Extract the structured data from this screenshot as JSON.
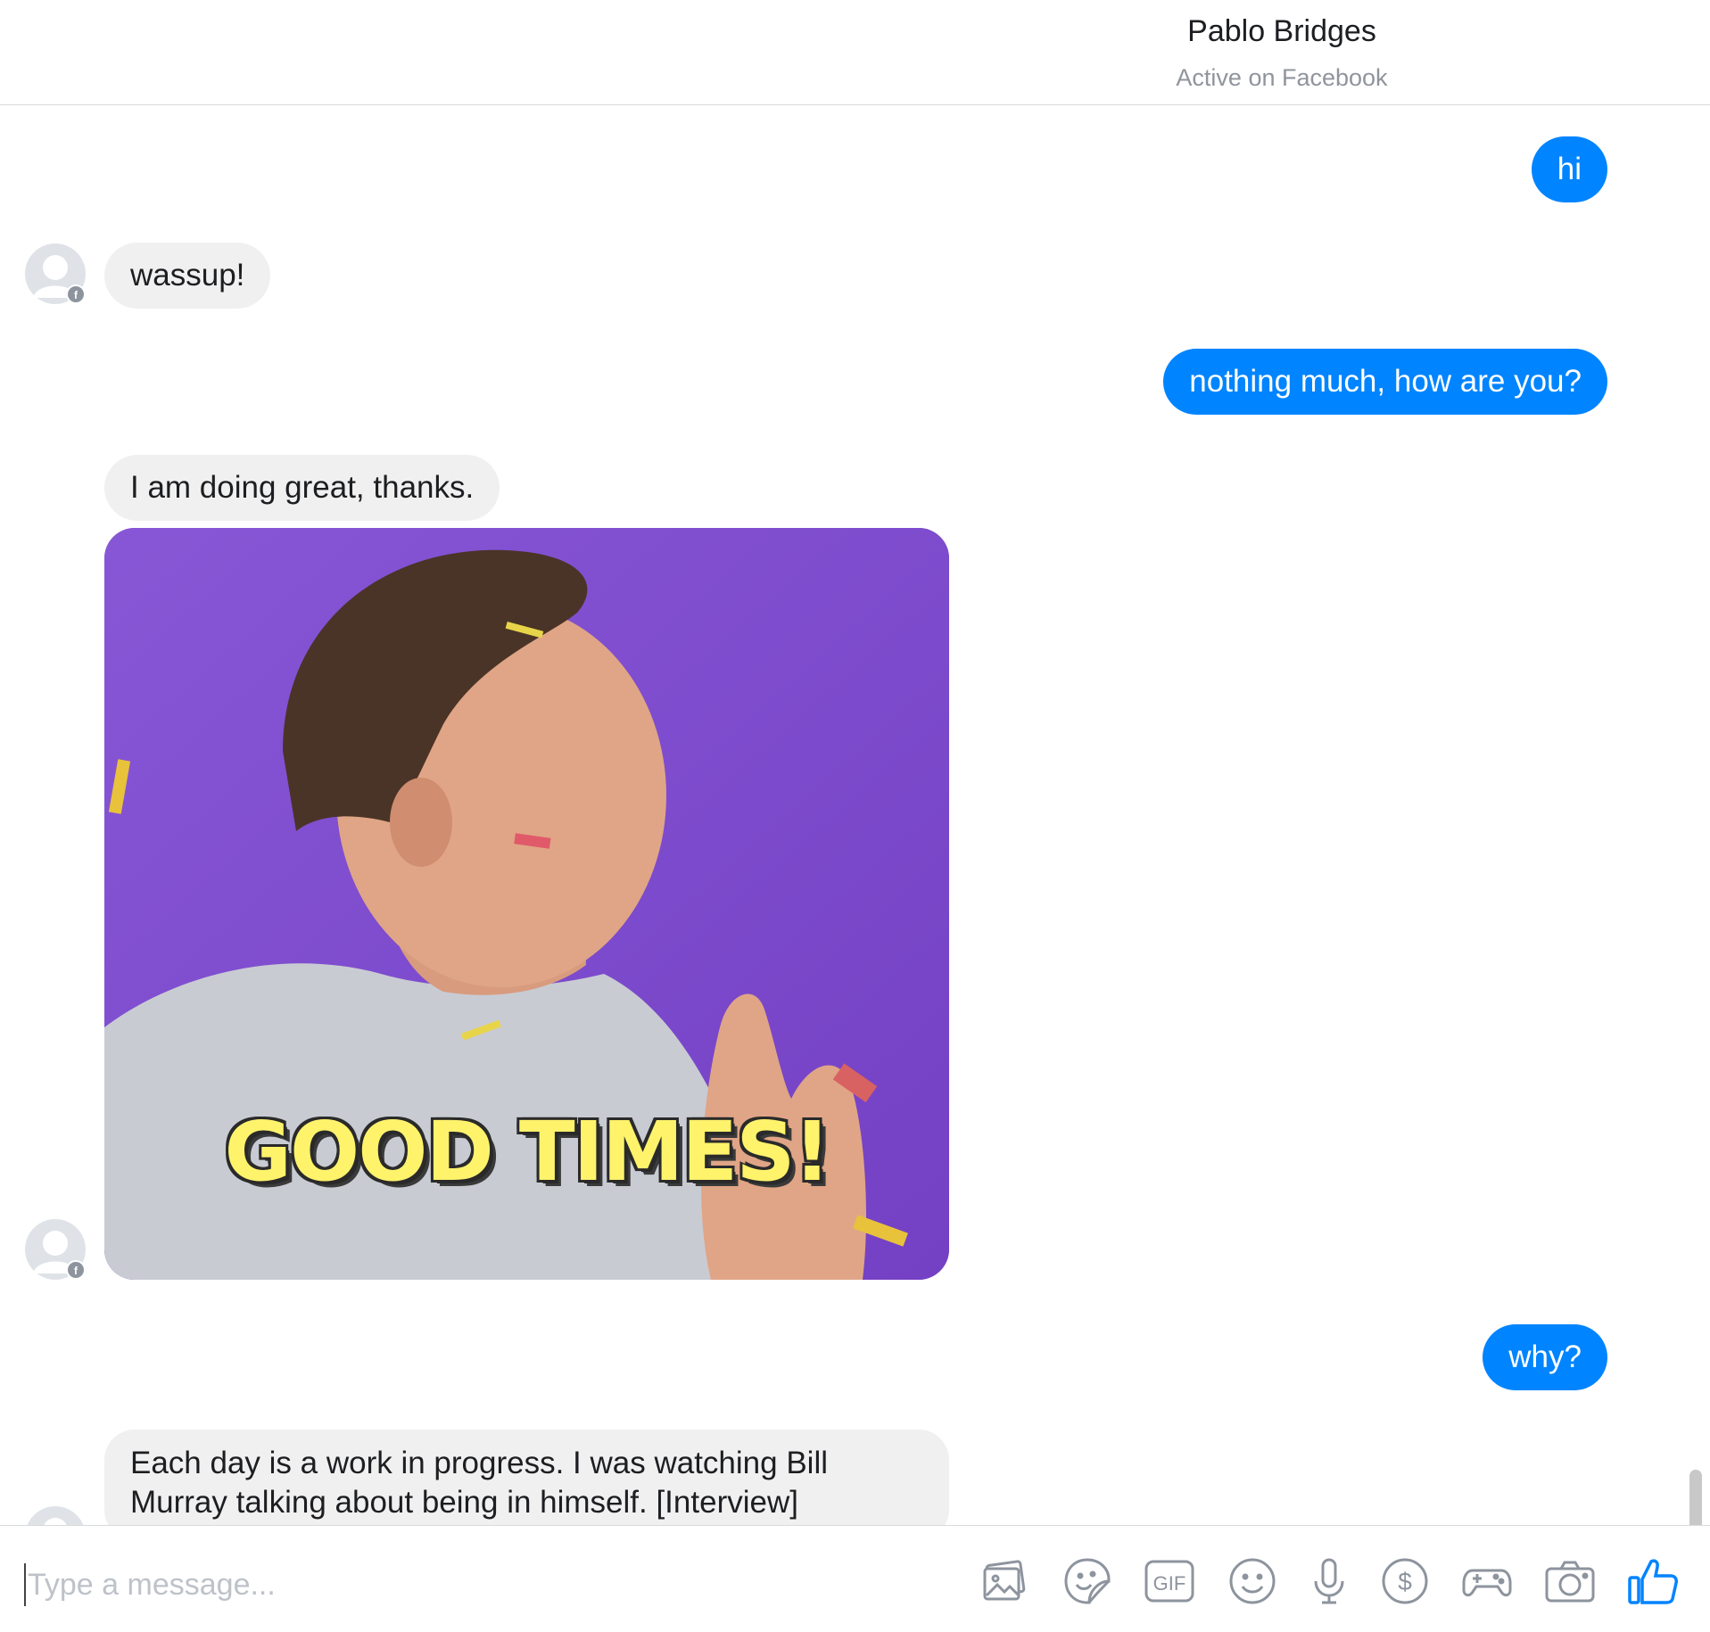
{
  "header": {
    "contact_name": "Pablo Bridges",
    "status": "Active on Facebook"
  },
  "messages": [
    {
      "direction": "out",
      "text": "hi"
    },
    {
      "direction": "in",
      "text": "wassup!"
    },
    {
      "direction": "out",
      "text": "nothing much, how are you?"
    },
    {
      "direction": "in",
      "text": "I am doing great, thanks."
    },
    {
      "direction": "in",
      "type": "gif",
      "caption": "GOOD TIMES!"
    },
    {
      "direction": "out",
      "text": "why?"
    },
    {
      "direction": "in",
      "text": "Each day is a work in progress. I was watching Bill Murray talking about being in himself. [Interview]"
    }
  ],
  "composer": {
    "placeholder": "Type a message...",
    "tools": [
      "image-icon",
      "sticker-icon",
      "gif-icon",
      "emoji-icon",
      "microphone-icon",
      "payment-icon",
      "game-icon",
      "camera-icon",
      "thumbs-up-icon"
    ],
    "gif_label": "GIF",
    "payment_symbol": "$"
  },
  "colors": {
    "outgoing_bubble": "#0084ff",
    "incoming_bubble": "#f1f0f0",
    "gif_background": "#7e47cc",
    "icon_gray": "#8d949e",
    "like_blue": "#0084ff"
  }
}
